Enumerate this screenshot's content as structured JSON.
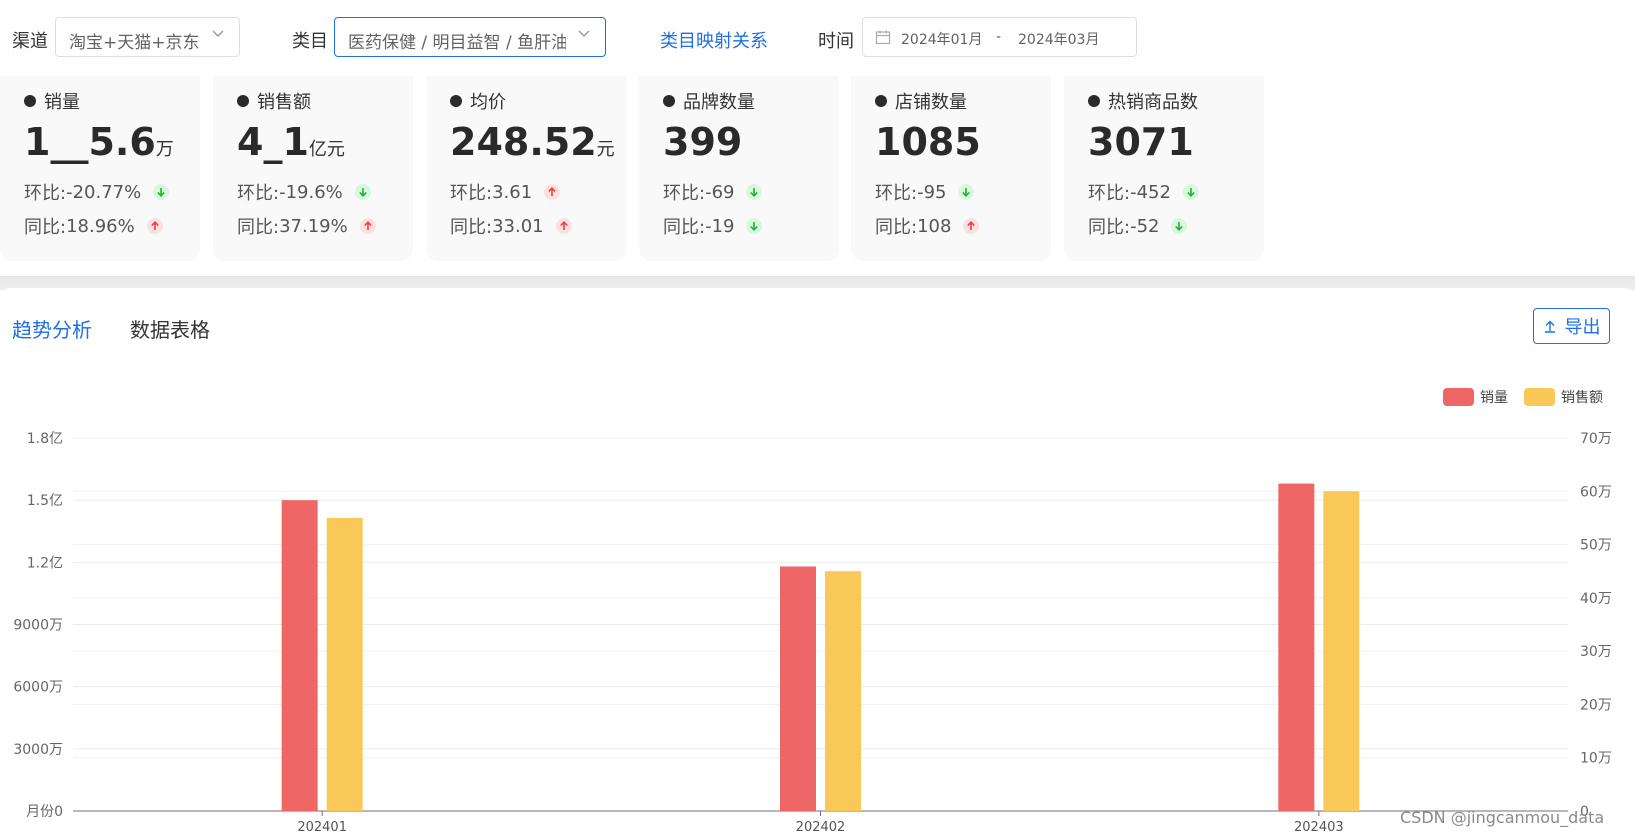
{
  "filters": {
    "channel_label": "渠道",
    "channel_value": "淘宝+天猫+京东",
    "category_label": "类目",
    "category_value": "医药保健 / 明目益智 / 鱼肝油",
    "mapping_link": "类目映射关系",
    "time_label": "时间",
    "date_start": "2024年01月",
    "date_sep": "-",
    "date_end": "2024年03月"
  },
  "kpis": [
    {
      "title": "销量",
      "value": "1__5.6",
      "unit": "万",
      "mom_label": "环比:",
      "mom": "-20.77%",
      "mom_dir": "down",
      "yoy_label": "同比:",
      "yoy": "18.96%",
      "yoy_dir": "up"
    },
    {
      "title": "销售额",
      "value": "4_1",
      "unit": "亿元",
      "mom_label": "环比:",
      "mom": "-19.6%",
      "mom_dir": "down",
      "yoy_label": "同比:",
      "yoy": "37.19%",
      "yoy_dir": "up"
    },
    {
      "title": "均价",
      "value": "248.52",
      "unit": "元",
      "mom_label": "环比:",
      "mom": "3.61",
      "mom_dir": "up",
      "yoy_label": "同比:",
      "yoy": "33.01",
      "yoy_dir": "up"
    },
    {
      "title": "品牌数量",
      "value": "399",
      "unit": "",
      "mom_label": "环比:",
      "mom": "-69",
      "mom_dir": "down",
      "yoy_label": "同比:",
      "yoy": "-19",
      "yoy_dir": "down"
    },
    {
      "title": "店铺数量",
      "value": "1085",
      "unit": "",
      "mom_label": "环比:",
      "mom": "-95",
      "mom_dir": "down",
      "yoy_label": "同比:",
      "yoy": "108",
      "yoy_dir": "up"
    },
    {
      "title": "热销商品数",
      "value": "3071",
      "unit": "",
      "mom_label": "环比:",
      "mom": "-452",
      "mom_dir": "down",
      "yoy_label": "同比:",
      "yoy": "-52",
      "yoy_dir": "down"
    }
  ],
  "tabs": [
    {
      "label": "趋势分析",
      "active": true
    },
    {
      "label": "数据表格",
      "active": false
    }
  ],
  "export_label": "导出",
  "colors": {
    "accent": "#1f6fe5",
    "series1": "#ee6666",
    "series2": "#fac858",
    "up": "#f23c3c",
    "down": "#20b13a"
  },
  "chart_data": {
    "type": "bar",
    "categories": [
      "202401",
      "202402",
      "202403"
    ],
    "series": [
      {
        "name": "销量",
        "axis": "left",
        "values": [
          150000000,
          118000000,
          158000000
        ]
      },
      {
        "name": "销售额",
        "axis": "right",
        "values": [
          550000,
          450000,
          600000
        ]
      }
    ],
    "y_left": {
      "min": 0,
      "max": 180000000,
      "ticks": [
        "0",
        "3000万",
        "6000万",
        "9000万",
        "1.2亿",
        "1.5亿",
        "1.8亿"
      ],
      "label": "月份"
    },
    "y_right": {
      "min": 0,
      "max": 700000,
      "ticks": [
        "0",
        "10万",
        "20万",
        "30万",
        "40万",
        "50万",
        "60万",
        "70万"
      ]
    },
    "legend_position": "top-right",
    "grid": true
  },
  "watermark": "CSDN @jingcanmou_data"
}
